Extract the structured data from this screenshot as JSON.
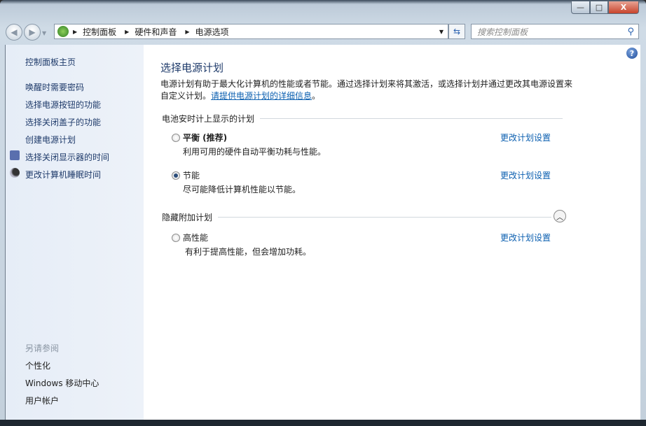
{
  "window": {
    "minimize": "—",
    "maximize": "□",
    "close": "X"
  },
  "address": {
    "crumbs": [
      "控制面板",
      "硬件和声音",
      "电源选项"
    ],
    "search_placeholder": "搜索控制面板"
  },
  "sidebar": {
    "home": "控制面板主页",
    "items": [
      "唤醒时需要密码",
      "选择电源按钮的功能",
      "选择关闭盖子的功能",
      "创建电源计划",
      "选择关闭显示器的时间",
      "更改计算机睡眠时间"
    ],
    "see_also_heading": "另请参阅",
    "see_also": [
      "个性化",
      "Windows 移动中心",
      "用户帐户"
    ]
  },
  "main": {
    "title": "选择电源计划",
    "desc": "电源计划有助于最大化计算机的性能或者节能。通过选择计划来将其激活，或选择计划并通过更改其电源设置来自定义计划。",
    "desc_link": "请提供电源计划的详细信息",
    "desc_end": "。",
    "section1": "电池安时计上显示的计划",
    "section2": "隐藏附加计划",
    "change_label": "更改计划设置",
    "plans": [
      {
        "name": "平衡 (推荐)",
        "desc": "利用可用的硬件自动平衡功耗与性能。",
        "selected": false
      },
      {
        "name": "节能",
        "desc": "尽可能降低计算机性能以节能。",
        "selected": true
      },
      {
        "name": "高性能",
        "desc": "有利于提高性能，但会增加功耗。",
        "selected": false
      }
    ]
  }
}
